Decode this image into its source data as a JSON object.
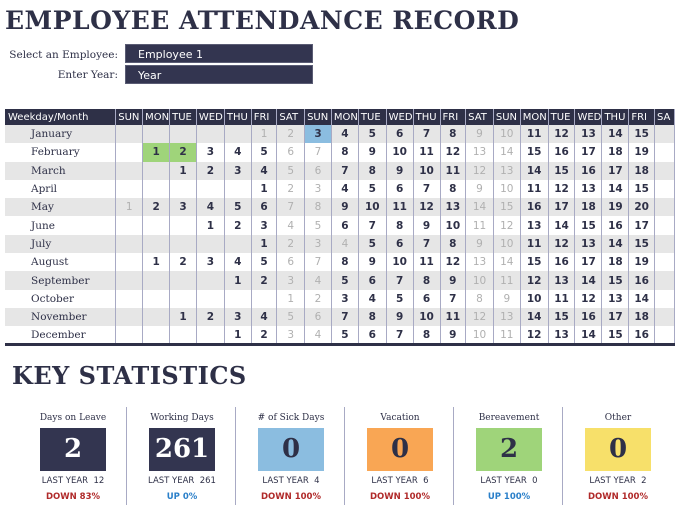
{
  "title": "EMPLOYEE ATTENDANCE RECORD",
  "fields": {
    "employee_label": "Select an Employee:",
    "employee_value": "Employee 1",
    "year_label": "Enter Year:",
    "year_value": "Year"
  },
  "calendar": {
    "corner_header": "Weekday/Month",
    "weekday_headers": [
      "SUN",
      "MON",
      "TUE",
      "WED",
      "THU",
      "FRI",
      "SAT",
      "SUN",
      "MON",
      "TUE",
      "WED",
      "THU",
      "FRI",
      "SAT",
      "SUN",
      "MON",
      "TUE",
      "WED",
      "THU",
      "FRI",
      "SA"
    ],
    "months": [
      {
        "name": "January",
        "offset": 5,
        "days": 15,
        "holidays": [
          1
        ],
        "sick": [
          3
        ],
        "bereavement": []
      },
      {
        "name": "February",
        "offset": 1,
        "days": 19,
        "holidays": [],
        "sick": [],
        "bereavement": [
          1,
          2
        ]
      },
      {
        "name": "March",
        "offset": 2,
        "days": 18,
        "holidays": [],
        "sick": [],
        "bereavement": []
      },
      {
        "name": "April",
        "offset": 5,
        "days": 15,
        "holidays": [],
        "sick": [],
        "bereavement": []
      },
      {
        "name": "May",
        "offset": 0,
        "days": 20,
        "holidays": [],
        "sick": [],
        "bereavement": []
      },
      {
        "name": "June",
        "offset": 3,
        "days": 17,
        "holidays": [],
        "sick": [],
        "bereavement": []
      },
      {
        "name": "July",
        "offset": 5,
        "days": 15,
        "holidays": [
          4
        ],
        "sick": [],
        "bereavement": []
      },
      {
        "name": "August",
        "offset": 1,
        "days": 19,
        "holidays": [],
        "sick": [],
        "bereavement": []
      },
      {
        "name": "September",
        "offset": 4,
        "days": 16,
        "holidays": [],
        "sick": [],
        "bereavement": []
      },
      {
        "name": "October",
        "offset": 6,
        "days": 14,
        "holidays": [],
        "sick": [],
        "bereavement": []
      },
      {
        "name": "November",
        "offset": 2,
        "days": 18,
        "holidays": [],
        "sick": [],
        "bereavement": []
      },
      {
        "name": "December",
        "offset": 4,
        "days": 16,
        "holidays": [],
        "sick": [],
        "bereavement": []
      }
    ],
    "colors": {
      "sick": "#8bbde0",
      "bereavement": "#9fd47a"
    }
  },
  "key_statistics": {
    "title": "KEY STATISTICS",
    "stats": [
      {
        "label": "Days on Leave",
        "value": "2",
        "last_year": "LAST YEAR  12",
        "change": "DOWN 83%",
        "direction": "down",
        "color": "#333550",
        "text_color": "#ffffff"
      },
      {
        "label": "Working Days",
        "value": "261",
        "last_year": "LAST YEAR  261",
        "change": "UP 0%",
        "direction": "up",
        "color": "#333550",
        "text_color": "#ffffff"
      },
      {
        "label": "# of Sick Days",
        "value": "0",
        "last_year": "LAST YEAR  4",
        "change": "DOWN 100%",
        "direction": "down",
        "color": "#8bbde0",
        "text_color": "#2e3047"
      },
      {
        "label": "Vacation",
        "value": "0",
        "last_year": "LAST YEAR  6",
        "change": "DOWN 100%",
        "direction": "down",
        "color": "#f9a654",
        "text_color": "#2e3047"
      },
      {
        "label": "Bereavement",
        "value": "2",
        "last_year": "LAST YEAR  0",
        "change": "UP 100%",
        "direction": "up",
        "color": "#9fd47a",
        "text_color": "#2e3047"
      },
      {
        "label": "Other",
        "value": "0",
        "last_year": "LAST YEAR  2",
        "change": "DOWN 100%",
        "direction": "down",
        "color": "#f7e06a",
        "text_color": "#2e3047"
      }
    ],
    "change_colors": {
      "up": "#2a7fc9",
      "down": "#b02a2a"
    }
  }
}
